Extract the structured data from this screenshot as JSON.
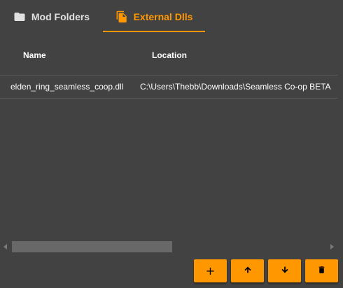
{
  "tabs": [
    {
      "label": "Mod Folders",
      "icon": "folder-icon",
      "active": false
    },
    {
      "label": "External Dlls",
      "icon": "file-icon",
      "active": true
    }
  ],
  "colors": {
    "accent": "#ff9800",
    "background": "#424242",
    "inactive_tab_text": "#e0e0e0",
    "scroll_thumb": "#686868"
  },
  "table": {
    "columns": [
      "Name",
      "Location"
    ],
    "rows": [
      {
        "name": "elden_ring_seamless_coop.dll",
        "location": "C:\\Users\\Thebb\\Downloads\\Seamless Co-op BETA"
      }
    ]
  },
  "scrollbar": {
    "left_icon": "chevron-left-icon",
    "right_icon": "chevron-right-icon"
  },
  "actions": {
    "add_label": "+",
    "move_up_icon": "arrow-up-icon",
    "move_down_icon": "arrow-down-icon",
    "delete_icon": "trash-icon"
  }
}
